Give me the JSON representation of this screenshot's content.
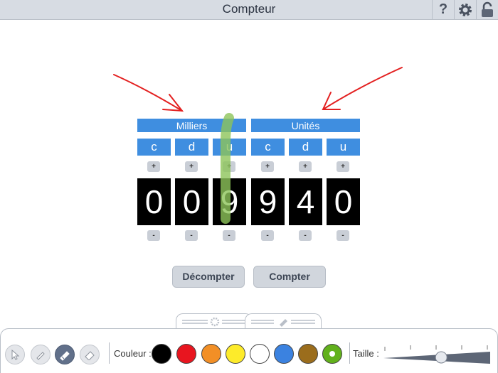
{
  "app": {
    "title": "Compteur"
  },
  "titlebar": {
    "help_glyph": "?",
    "icons": [
      "help-icon",
      "gear-icon",
      "lock-icon"
    ]
  },
  "groups": {
    "thousands": "Milliers",
    "units": "Unités"
  },
  "digit_labels": [
    "c",
    "d",
    "u",
    "c",
    "d",
    "u"
  ],
  "digits": [
    "0",
    "0",
    "9",
    "9",
    "4",
    "0"
  ],
  "plus_label": "+",
  "minus_label": "-",
  "buttons": {
    "count_down": "Décompter",
    "count_up": "Compter"
  },
  "toolbar": {
    "tools": [
      "pointer-tool-icon",
      "pen-tool-icon",
      "highlighter-tool-icon",
      "eraser-tool-icon"
    ],
    "active_tool": "highlighter-tool-icon",
    "color_label": "Couleur :",
    "colors": [
      "#000000",
      "#e8151f",
      "#f28f26",
      "#fdeb2a",
      "#ffffff",
      "#3b82e0",
      "#9b6d1c",
      "#62b11c"
    ],
    "selected_color": "#62b11c",
    "size_label": "Taille :",
    "size_level": 0.55
  },
  "annotations": {
    "stroke_color": "#e32020",
    "highlight_color": "#8dc45a"
  }
}
